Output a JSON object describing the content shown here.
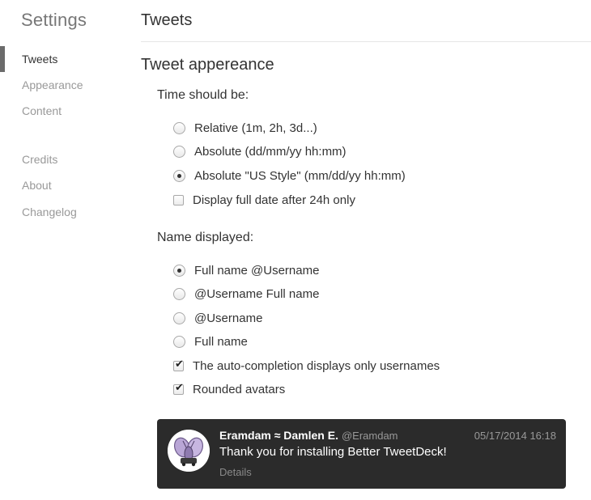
{
  "sidebar": {
    "title": "Settings",
    "items": [
      {
        "label": "Tweets",
        "active": true
      },
      {
        "label": "Appearance"
      },
      {
        "label": "Content"
      },
      {
        "label": "Credits"
      },
      {
        "label": "About"
      },
      {
        "label": "Changelog"
      }
    ]
  },
  "main": {
    "title": "Tweets",
    "section_title": "Tweet appereance",
    "time_group": {
      "label": "Time should be:",
      "options": [
        {
          "label": "Relative (1m, 2h, 3d...)",
          "checked": false
        },
        {
          "label": "Absolute (dd/mm/yy hh:mm)",
          "checked": false
        },
        {
          "label": "Absolute \"US Style\" (mm/dd/yy hh:mm)",
          "checked": true
        }
      ],
      "full_date_checkbox": {
        "label": "Display full date after 24h only",
        "checked": false
      }
    },
    "name_group": {
      "label": "Name displayed:",
      "options": [
        {
          "label": "Full name @Username",
          "checked": true
        },
        {
          "label": "@Username Full name",
          "checked": false
        },
        {
          "label": "@Username",
          "checked": false
        },
        {
          "label": "Full name",
          "checked": false
        }
      ],
      "autocomplete_checkbox": {
        "label": "The auto-completion displays only usernames",
        "checked": true
      },
      "rounded_avatars_checkbox": {
        "label": "Rounded avatars",
        "checked": true
      }
    }
  },
  "tweet_preview": {
    "author": "Eramdam ≈ Damlen E.",
    "handle": "@Eramdam",
    "timestamp": "05/17/2014 16:18",
    "text": "Thank you for installing Better TweetDeck!",
    "details_label": "Details",
    "check_glyph": "✔",
    "colors": {
      "card_bg": "#2b2b2b",
      "text": "#ffffff",
      "muted": "#999999"
    }
  }
}
